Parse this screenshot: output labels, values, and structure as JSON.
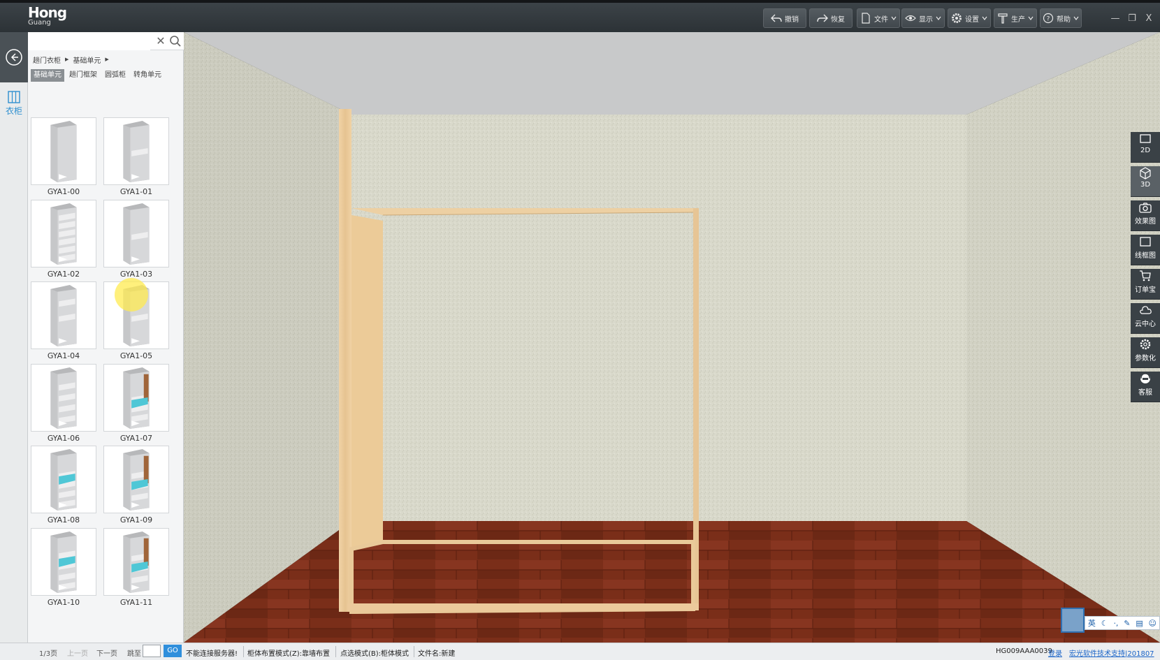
{
  "app": {
    "logo_main": "Hong",
    "logo_sub": "Guang"
  },
  "toolbar": {
    "undo": "撤销",
    "redo": "恢复",
    "file": "文件",
    "display": "显示",
    "settings": "设置",
    "produce": "生产",
    "help": "帮助"
  },
  "window_controls": {
    "minimize": "—",
    "restore": "❐",
    "close": "X"
  },
  "leftnav": {
    "item": "衣柜"
  },
  "library": {
    "search_placeholder": "",
    "breadcrumb": [
      "趟门衣柜",
      "基础单元"
    ],
    "tabs": [
      "基础单元",
      "趟门框架",
      "圆弧柜",
      "转角单元"
    ],
    "active_tab": 0,
    "items": [
      {
        "label": "GYA1-00"
      },
      {
        "label": "GYA1-01"
      },
      {
        "label": "GYA1-02"
      },
      {
        "label": "GYA1-03"
      },
      {
        "label": "GYA1-04"
      },
      {
        "label": "GYA1-05"
      },
      {
        "label": "GYA1-06"
      },
      {
        "label": "GYA1-07"
      },
      {
        "label": "GYA1-08"
      },
      {
        "label": "GYA1-09"
      },
      {
        "label": "GYA1-10"
      },
      {
        "label": "GYA1-11"
      }
    ]
  },
  "pager": {
    "page": "1/3页",
    "prev": "上一页",
    "next": "下一页",
    "goto": "跳至",
    "go": "GO"
  },
  "status": {
    "server": "不能连接服务器!",
    "layout_mode": "柜体布置模式(Z):靠墙布置",
    "select_mode": "点选模式(B):柜体模式",
    "file_name": "文件名:新建",
    "code": "HG009AAA0039",
    "login": "登录",
    "support": "宏光软件技术支持|201807"
  },
  "rightbar": [
    "2D",
    "3D",
    "效果图",
    "线框图",
    "订单宝",
    "云中心",
    "参数化",
    "客服"
  ],
  "tray": {
    "ime": "英"
  },
  "colors": {
    "accent": "#2f8fdc",
    "toolbar_bg": "#353b40",
    "wood": "#e8c79a",
    "floor": "#7a2f1a",
    "wall": "#d7d7c9",
    "ceiling": "#c9cacb"
  }
}
